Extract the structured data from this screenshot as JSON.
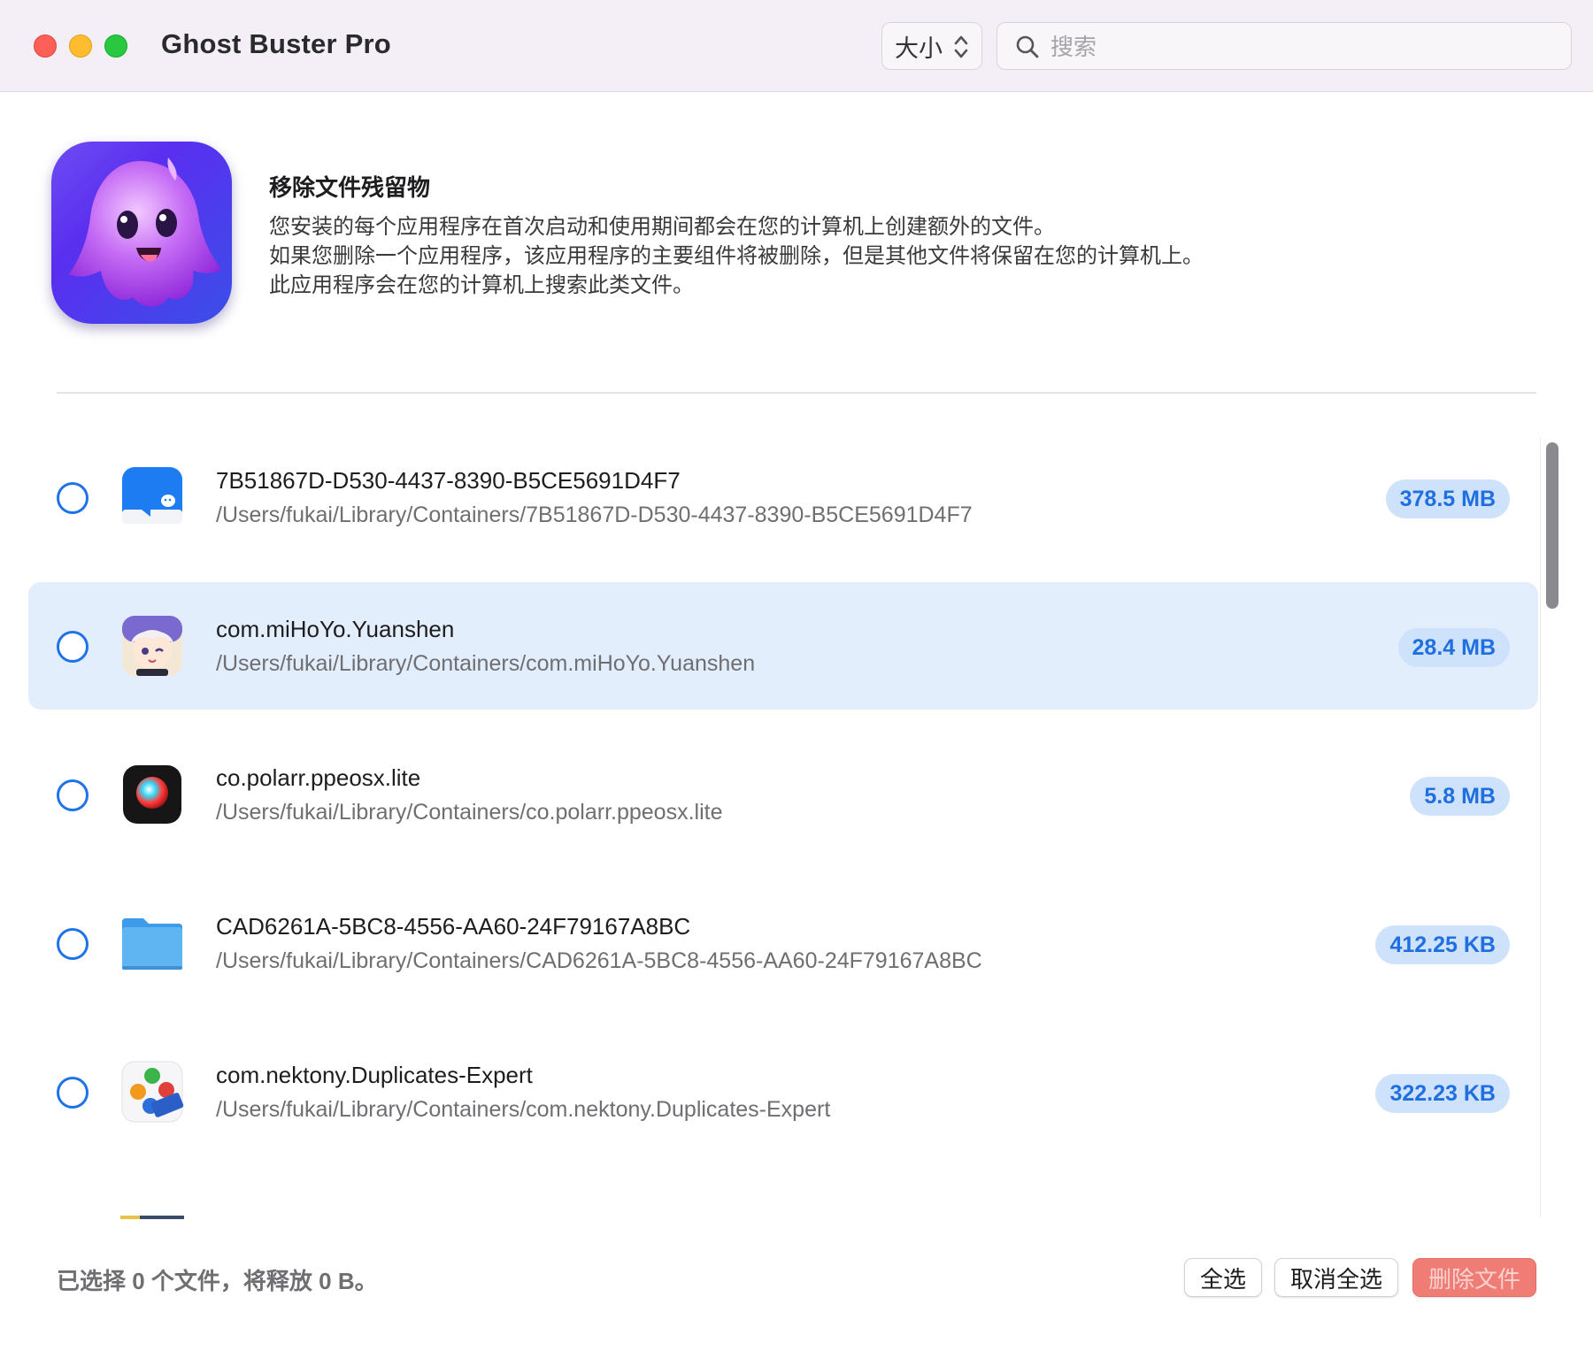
{
  "window": {
    "title": "Ghost Buster Pro",
    "sort": {
      "selected": "大小"
    },
    "search": {
      "placeholder": "搜索",
      "value": ""
    }
  },
  "header": {
    "title": "移除文件残留物",
    "description_lines": [
      "您安装的每个应用程序在首次启动和使用期间都会在您的计算机上创建额外的文件。",
      "如果您删除一个应用程序，该应用程序的主要组件将被删除，但是其他文件将保留在您的计算机上。",
      "此应用程序会在您的计算机上搜索此类文件。"
    ]
  },
  "files": [
    {
      "name": "7B51867D-D530-4437-8390-B5CE5691D4F7",
      "path": "/Users/fukai/Library/Containers/7B51867D-D530-4437-8390-B5CE5691D4F7",
      "size": "378.5 MB",
      "icon": "chat-app-icon",
      "checked": false,
      "highlighted": false
    },
    {
      "name": "com.miHoYo.Yuanshen",
      "path": "/Users/fukai/Library/Containers/com.miHoYo.Yuanshen",
      "size": "28.4 MB",
      "icon": "game-character-icon",
      "checked": false,
      "highlighted": true
    },
    {
      "name": "co.polarr.ppeosx.lite",
      "path": "/Users/fukai/Library/Containers/co.polarr.ppeosx.lite",
      "size": "5.8 MB",
      "icon": "polarr-app-icon",
      "checked": false,
      "highlighted": false
    },
    {
      "name": "CAD6261A-5BC8-4556-AA60-24F79167A8BC",
      "path": "/Users/fukai/Library/Containers/CAD6261A-5BC8-4556-AA60-24F79167A8BC",
      "size": "412.25 KB",
      "icon": "folder-icon",
      "checked": false,
      "highlighted": false
    },
    {
      "name": "com.nektony.Duplicates-Expert",
      "path": "/Users/fukai/Library/Containers/com.nektony.Duplicates-Expert",
      "size": "322.23 KB",
      "icon": "duplicates-pro-icon",
      "checked": false,
      "highlighted": false
    }
  ],
  "footer": {
    "status": "已选择 0 个文件，将释放 0 B。",
    "select_all": "全选",
    "deselect_all": "取消全选",
    "delete": "删除文件"
  },
  "colors": {
    "accent": "#1f73e8",
    "badge_bg": "#cfe2fb",
    "row_highlight": "#e3eefd",
    "delete_button": "#ef7d76",
    "titlebar": "#f4eff6"
  }
}
